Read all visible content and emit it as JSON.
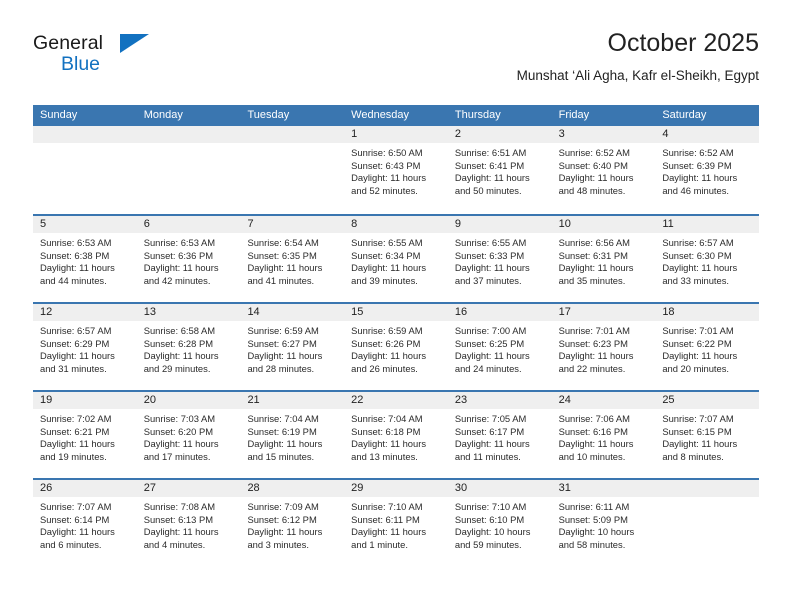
{
  "brand": {
    "word_one": "General",
    "word_two": "Blue",
    "triangle_icon": "triangle-icon",
    "colors": {
      "blue": "#1271c0",
      "dark": "#1a1a1a"
    }
  },
  "header": {
    "title": "October 2025",
    "subtitle": "Munshat ‘Ali Agha, Kafr el-Sheikh, Egypt"
  },
  "theme": {
    "header_blue": "#3a76b0",
    "day_band_gray": "#efefef",
    "text": "#2b2b2b"
  },
  "calendar": {
    "weekday_headers": [
      "Sunday",
      "Monday",
      "Tuesday",
      "Wednesday",
      "Thursday",
      "Friday",
      "Saturday"
    ],
    "labels": {
      "sunrise": "Sunrise:",
      "sunset": "Sunset:",
      "daylight": "Daylight:"
    },
    "weeks": [
      [
        {
          "day": "",
          "lines": []
        },
        {
          "day": "",
          "lines": []
        },
        {
          "day": "",
          "lines": []
        },
        {
          "day": "1",
          "lines": [
            "Sunrise: 6:50 AM",
            "Sunset: 6:43 PM",
            "Daylight: 11 hours",
            "and 52 minutes."
          ]
        },
        {
          "day": "2",
          "lines": [
            "Sunrise: 6:51 AM",
            "Sunset: 6:41 PM",
            "Daylight: 11 hours",
            "and 50 minutes."
          ]
        },
        {
          "day": "3",
          "lines": [
            "Sunrise: 6:52 AM",
            "Sunset: 6:40 PM",
            "Daylight: 11 hours",
            "and 48 minutes."
          ]
        },
        {
          "day": "4",
          "lines": [
            "Sunrise: 6:52 AM",
            "Sunset: 6:39 PM",
            "Daylight: 11 hours",
            "and 46 minutes."
          ]
        }
      ],
      [
        {
          "day": "5",
          "lines": [
            "Sunrise: 6:53 AM",
            "Sunset: 6:38 PM",
            "Daylight: 11 hours",
            "and 44 minutes."
          ]
        },
        {
          "day": "6",
          "lines": [
            "Sunrise: 6:53 AM",
            "Sunset: 6:36 PM",
            "Daylight: 11 hours",
            "and 42 minutes."
          ]
        },
        {
          "day": "7",
          "lines": [
            "Sunrise: 6:54 AM",
            "Sunset: 6:35 PM",
            "Daylight: 11 hours",
            "and 41 minutes."
          ]
        },
        {
          "day": "8",
          "lines": [
            "Sunrise: 6:55 AM",
            "Sunset: 6:34 PM",
            "Daylight: 11 hours",
            "and 39 minutes."
          ]
        },
        {
          "day": "9",
          "lines": [
            "Sunrise: 6:55 AM",
            "Sunset: 6:33 PM",
            "Daylight: 11 hours",
            "and 37 minutes."
          ]
        },
        {
          "day": "10",
          "lines": [
            "Sunrise: 6:56 AM",
            "Sunset: 6:31 PM",
            "Daylight: 11 hours",
            "and 35 minutes."
          ]
        },
        {
          "day": "11",
          "lines": [
            "Sunrise: 6:57 AM",
            "Sunset: 6:30 PM",
            "Daylight: 11 hours",
            "and 33 minutes."
          ]
        }
      ],
      [
        {
          "day": "12",
          "lines": [
            "Sunrise: 6:57 AM",
            "Sunset: 6:29 PM",
            "Daylight: 11 hours",
            "and 31 minutes."
          ]
        },
        {
          "day": "13",
          "lines": [
            "Sunrise: 6:58 AM",
            "Sunset: 6:28 PM",
            "Daylight: 11 hours",
            "and 29 minutes."
          ]
        },
        {
          "day": "14",
          "lines": [
            "Sunrise: 6:59 AM",
            "Sunset: 6:27 PM",
            "Daylight: 11 hours",
            "and 28 minutes."
          ]
        },
        {
          "day": "15",
          "lines": [
            "Sunrise: 6:59 AM",
            "Sunset: 6:26 PM",
            "Daylight: 11 hours",
            "and 26 minutes."
          ]
        },
        {
          "day": "16",
          "lines": [
            "Sunrise: 7:00 AM",
            "Sunset: 6:25 PM",
            "Daylight: 11 hours",
            "and 24 minutes."
          ]
        },
        {
          "day": "17",
          "lines": [
            "Sunrise: 7:01 AM",
            "Sunset: 6:23 PM",
            "Daylight: 11 hours",
            "and 22 minutes."
          ]
        },
        {
          "day": "18",
          "lines": [
            "Sunrise: 7:01 AM",
            "Sunset: 6:22 PM",
            "Daylight: 11 hours",
            "and 20 minutes."
          ]
        }
      ],
      [
        {
          "day": "19",
          "lines": [
            "Sunrise: 7:02 AM",
            "Sunset: 6:21 PM",
            "Daylight: 11 hours",
            "and 19 minutes."
          ]
        },
        {
          "day": "20",
          "lines": [
            "Sunrise: 7:03 AM",
            "Sunset: 6:20 PM",
            "Daylight: 11 hours",
            "and 17 minutes."
          ]
        },
        {
          "day": "21",
          "lines": [
            "Sunrise: 7:04 AM",
            "Sunset: 6:19 PM",
            "Daylight: 11 hours",
            "and 15 minutes."
          ]
        },
        {
          "day": "22",
          "lines": [
            "Sunrise: 7:04 AM",
            "Sunset: 6:18 PM",
            "Daylight: 11 hours",
            "and 13 minutes."
          ]
        },
        {
          "day": "23",
          "lines": [
            "Sunrise: 7:05 AM",
            "Sunset: 6:17 PM",
            "Daylight: 11 hours",
            "and 11 minutes."
          ]
        },
        {
          "day": "24",
          "lines": [
            "Sunrise: 7:06 AM",
            "Sunset: 6:16 PM",
            "Daylight: 11 hours",
            "and 10 minutes."
          ]
        },
        {
          "day": "25",
          "lines": [
            "Sunrise: 7:07 AM",
            "Sunset: 6:15 PM",
            "Daylight: 11 hours",
            "and 8 minutes."
          ]
        }
      ],
      [
        {
          "day": "26",
          "lines": [
            "Sunrise: 7:07 AM",
            "Sunset: 6:14 PM",
            "Daylight: 11 hours",
            "and 6 minutes."
          ]
        },
        {
          "day": "27",
          "lines": [
            "Sunrise: 7:08 AM",
            "Sunset: 6:13 PM",
            "Daylight: 11 hours",
            "and 4 minutes."
          ]
        },
        {
          "day": "28",
          "lines": [
            "Sunrise: 7:09 AM",
            "Sunset: 6:12 PM",
            "Daylight: 11 hours",
            "and 3 minutes."
          ]
        },
        {
          "day": "29",
          "lines": [
            "Sunrise: 7:10 AM",
            "Sunset: 6:11 PM",
            "Daylight: 11 hours",
            "and 1 minute."
          ]
        },
        {
          "day": "30",
          "lines": [
            "Sunrise: 7:10 AM",
            "Sunset: 6:10 PM",
            "Daylight: 10 hours",
            "and 59 minutes."
          ]
        },
        {
          "day": "31",
          "lines": [
            "Sunrise: 6:11 AM",
            "Sunset: 5:09 PM",
            "Daylight: 10 hours",
            "and 58 minutes."
          ]
        },
        {
          "day": "",
          "lines": []
        }
      ]
    ]
  }
}
